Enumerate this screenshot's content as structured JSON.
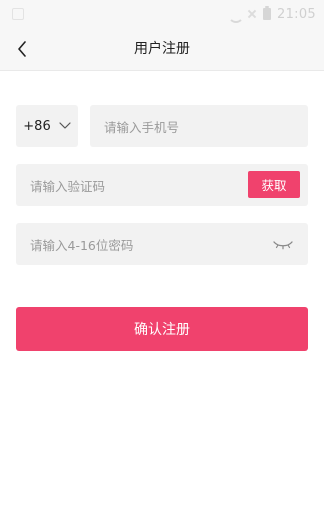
{
  "status_bar": {
    "time": "21:05"
  },
  "header": {
    "title": "用户注册"
  },
  "form": {
    "country_code": "+86",
    "phone_placeholder": "请输入手机号",
    "code_placeholder": "请输入验证码",
    "get_code_label": "获取",
    "password_placeholder": "请输入4-16位密码"
  },
  "actions": {
    "confirm_label": "确认注册"
  },
  "colors": {
    "accent": "#f0426d",
    "field_bg": "#f2f2f2",
    "header_bg": "#f7f7f7"
  },
  "icons": {
    "back": "chevron-left-icon",
    "country_dropdown": "chevron-down-icon",
    "password_visibility": "eye-closed-icon",
    "wifi": "wifi-icon",
    "close": "close-icon",
    "battery": "battery-icon"
  }
}
